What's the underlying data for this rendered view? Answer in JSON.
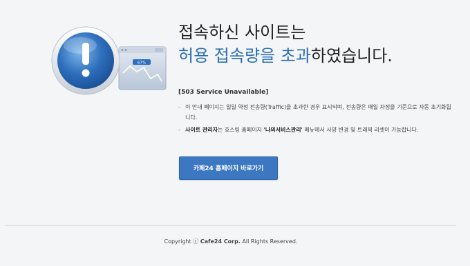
{
  "headline": {
    "line1": "접속하신 사이트는",
    "line2_highlight_1": "허용 접속량을 초과",
    "line2_rest": "하였습니다."
  },
  "details": {
    "code": "[503 Service Unavailable]",
    "item1": "이 안내 페이지는 일일 약정 전송량(Traffic)을 초과한 경우 표시되며, 전송량은 매일 자정을 기준으로 자동 초기화됩니다.",
    "item2_prefix": "사이트 관리자",
    "item2_mid": "는 호스팅 홈페이지 ",
    "item2_menu": "'나의서비스관리'",
    "item2_suffix": " 메뉴에서 사양 변경 및 트래픽 리셋이 가능합니다."
  },
  "button": {
    "label": "카페24 홈페이지 바로가기"
  },
  "illustration": {
    "gauge_text": "67%"
  },
  "footer": {
    "prefix": "Copyright ⓒ ",
    "brand": "Cafe24 Corp.",
    "suffix": " All Rights Reserved."
  },
  "colors": {
    "accent": "#2d6fb3",
    "button": "#3c78c2",
    "background": "#f4f5f7"
  }
}
